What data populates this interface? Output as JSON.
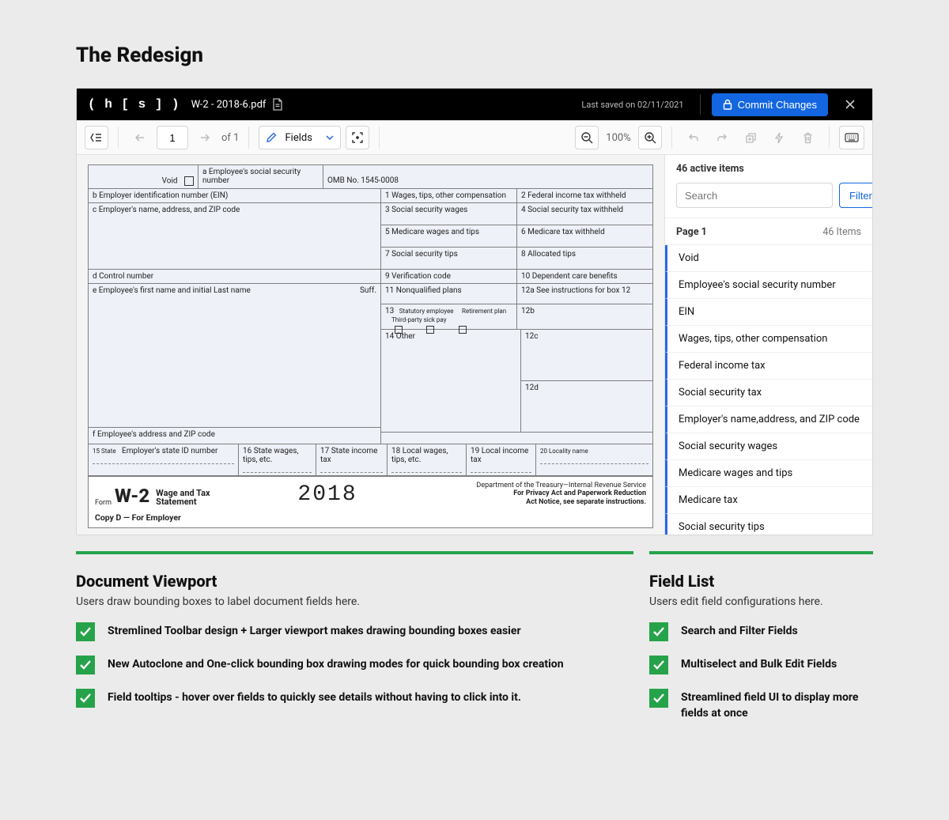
{
  "page_heading": "The Redesign",
  "titlebar": {
    "brand": "( h [ s ] )",
    "file_name": "W-2 - 2018-6.pdf",
    "last_saved": "Last saved on 02/11/2021",
    "commit_label": "Commit Changes"
  },
  "toolbar": {
    "page_current": "1",
    "page_of": "of 1",
    "mode_label": "Fields",
    "zoom_pct": "100%"
  },
  "doc": {
    "void": "Void",
    "a": "a   Employee's social security number",
    "omb": "OMB No. 1545-0008",
    "b": "b   Employer identification number (EIN)",
    "l1": "1   Wages, tips, other compensation",
    "l2": "2   Federal income tax withheld",
    "c": "c   Employer's name, address, and ZIP code",
    "l3": "3   Social security wages",
    "l4": "4   Social security tax withheld",
    "l5": "5   Medicare wages and tips",
    "l6": "6   Medicare tax withheld",
    "l7": "7   Social security tips",
    "l8": "8   Allocated tips",
    "d": "d   Control number",
    "l9": "9   Verification code",
    "l10": "10   Dependent care benefits",
    "e": "e   Employee's first name and initial        Last name",
    "suff": "Suff.",
    "l11": "11   Nonqualified plans",
    "l12a": "12a  See instructions for box 12",
    "l13": "13",
    "l13a": "Statutory employee",
    "l13b": "Retirement plan",
    "l13c": "Third-party sick pay",
    "l12b": "12b",
    "l14": "14   Other",
    "l12c": "12c",
    "l12d": "12d",
    "f": "f   Employee's address and ZIP code",
    "l15": "15   State",
    "l15b": "Employer's state ID number",
    "l16": "16   State wages, tips, etc.",
    "l17": "17   State income tax",
    "l18": "18   Local wages, tips, etc.",
    "l19": "19   Local income tax",
    "l20": "20   Locality name",
    "form": "Form",
    "w2": "W-2",
    "wts_1": "Wage and Tax",
    "wts_2": "Statement",
    "year": "2018",
    "dept1": "Department of the Treasury—Internal Revenue Service",
    "dept2": "For Privacy Act and Paperwork Reduction",
    "dept3": "Act Notice, see separate instructions.",
    "copy": "Copy D — For Employer"
  },
  "panel": {
    "active_count": "46 active items",
    "search_placeholder": "Search",
    "filters_label": "Filters",
    "page_label": "Page 1",
    "page_count": "46 Items",
    "items": [
      "Void",
      "Employee's social security number",
      "EIN",
      "Wages, tips, other compensation",
      "Federal income tax",
      "Social security tax",
      "Employer's name,address, and ZIP code",
      "Social security wages",
      "Medicare wages and tips",
      "Medicare tax",
      "Social security tips"
    ]
  },
  "annotations": {
    "left": {
      "title": "Document Viewport",
      "subtitle": "Users draw bounding boxes to label document fields here.",
      "items": [
        "Stremlined Toolbar design + Larger viewport makes drawing bounding boxes easier",
        "New Autoclone and One-click bounding box drawing modes for quick bounding box creation",
        "Field tooltips - hover over fields to quickly see details without having to click into it."
      ]
    },
    "right": {
      "title": "Field List",
      "subtitle": "Users edit field configurations here.",
      "items": [
        "Search and Filter Fields",
        "Multiselect and Bulk Edit Fields",
        "Streamlined field UI to display more fields at once"
      ]
    }
  }
}
